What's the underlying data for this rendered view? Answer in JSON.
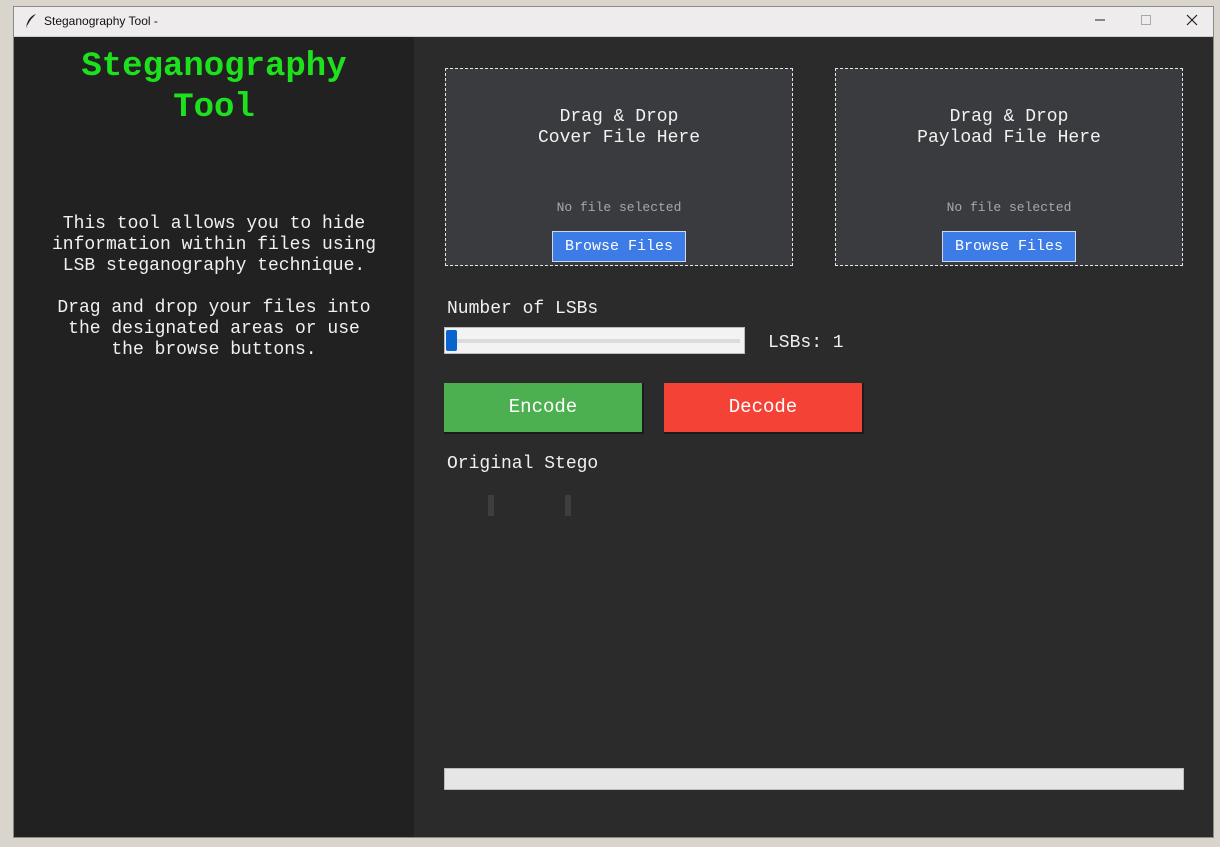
{
  "window": {
    "title": "Steganography Tool -"
  },
  "sidebar": {
    "app_title": "Steganography\nTool",
    "description": "This tool allows you to hide\ninformation within files using\nLSB steganography technique.\n\nDrag and drop your files into\nthe designated areas or use\nthe browse buttons."
  },
  "dropzones": {
    "cover": {
      "title": "Drag & Drop\nCover File Here",
      "status": "No file selected",
      "browse_label": "Browse Files"
    },
    "payload": {
      "title": "Drag & Drop\nPayload File Here",
      "status": "No file selected",
      "browse_label": "Browse Files"
    }
  },
  "lsb": {
    "label": "Number of LSBs",
    "value_text": "LSBs: 1",
    "value": 1
  },
  "actions": {
    "encode_label": "Encode",
    "decode_label": "Decode"
  },
  "images": {
    "labels": "Original Stego"
  },
  "progress": {
    "fraction": 0
  },
  "colors": {
    "title_green": "#1ee11e",
    "browse_blue": "#3d7be6",
    "encode_green": "#4caf50",
    "decode_red": "#f44336",
    "slider_thumb": "#0a64d0"
  },
  "icons": {
    "app_icon": "feather-icon",
    "minimize": "minimize-icon",
    "maximize": "maximize-icon",
    "close": "close-icon"
  }
}
